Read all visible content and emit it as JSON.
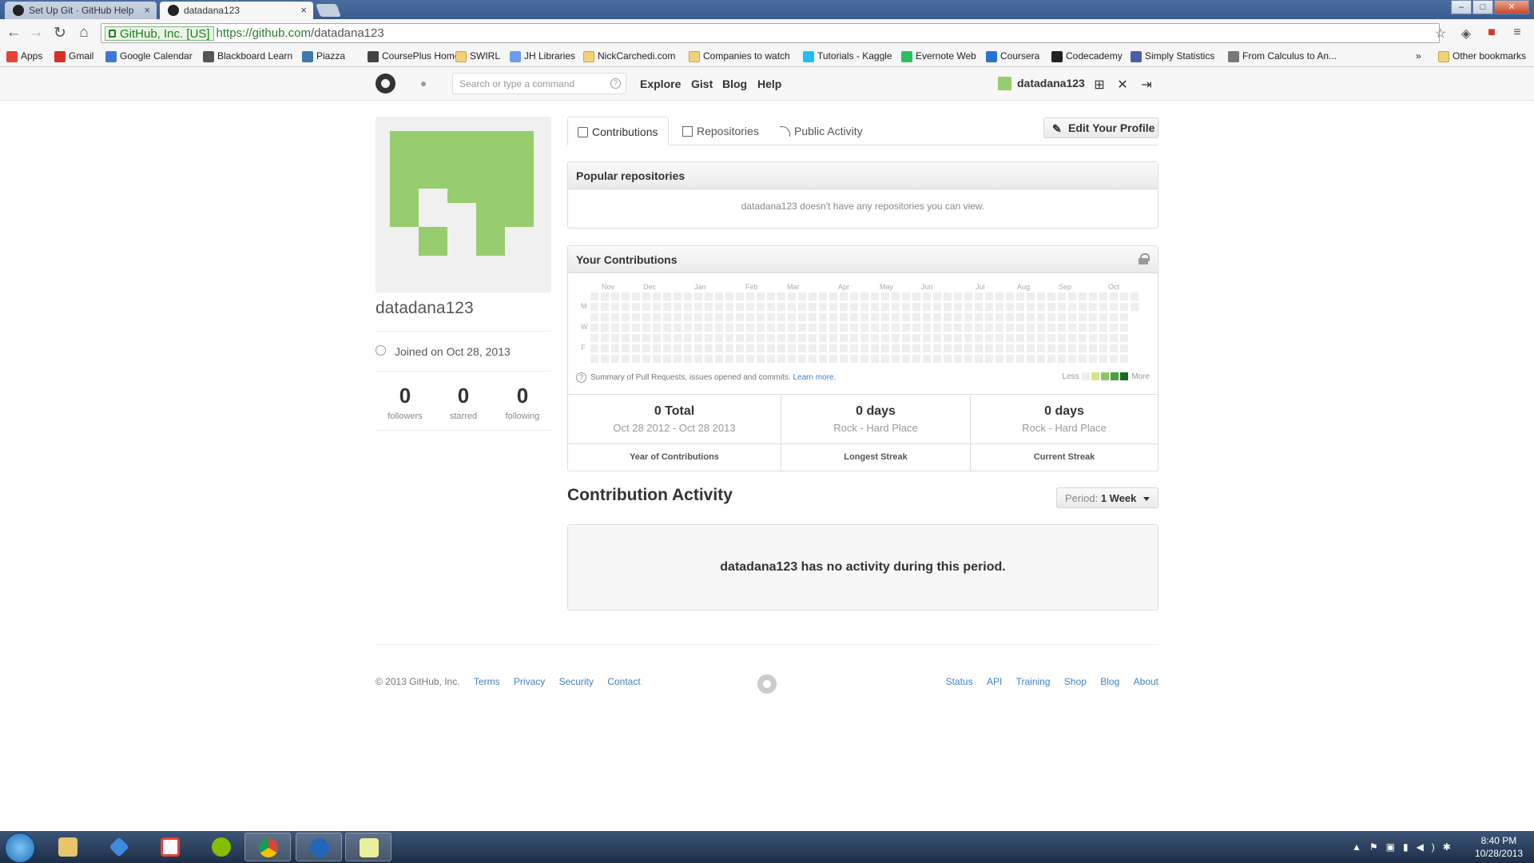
{
  "browser": {
    "tabs": [
      {
        "title": "Set Up Git · GitHub Help",
        "active": false
      },
      {
        "title": "datadana123",
        "active": true
      }
    ],
    "close_glyph": "×",
    "ev_label": "GitHub, Inc. [US]",
    "url_scheme_host": "https://github.com",
    "url_path": "/datadana123",
    "nav_icons": [
      "back-arrow-icon",
      "forward-arrow-icon",
      "reload-icon",
      "home-icon"
    ],
    "bookmarks": [
      {
        "label": "Apps",
        "icon": "apps-grid-icon",
        "color": "#e84235"
      },
      {
        "label": "Gmail",
        "icon": "gmail-icon",
        "color": "#d93025"
      },
      {
        "label": "Google Calendar",
        "icon": "calendar-icon",
        "color": "#3c78d8"
      },
      {
        "label": "Blackboard Learn",
        "icon": "blackboard-icon",
        "color": "#555555"
      },
      {
        "label": "Piazza",
        "icon": "piazza-icon",
        "color": "#3e7aab"
      },
      {
        "label": "CoursePlus Home",
        "icon": "courseplus-icon",
        "color": "#444444"
      },
      {
        "label": "SWIRL",
        "icon": "folder-icon",
        "color": "folder"
      },
      {
        "label": "JH Libraries",
        "icon": "jh-libraries-icon",
        "color": "#6d9eeb"
      },
      {
        "label": "NickCarchedi.com",
        "icon": "folder-icon",
        "color": "folder"
      },
      {
        "label": "Companies to watch",
        "icon": "folder-icon",
        "color": "folder"
      },
      {
        "label": "Tutorials - Kaggle",
        "icon": "kaggle-icon",
        "color": "#20beff"
      },
      {
        "label": "Evernote Web",
        "icon": "evernote-icon",
        "color": "#2dbe60"
      },
      {
        "label": "Coursera",
        "icon": "coursera-icon",
        "color": "#2a73cc"
      },
      {
        "label": "Codecademy",
        "icon": "codecademy-icon",
        "color": "#222222"
      },
      {
        "label": "Simply Statistics",
        "icon": "simply-statistics-icon",
        "color": "#4a5ea8"
      },
      {
        "label": "From Calculus to An...",
        "icon": "calculus-icon",
        "color": "#777777"
      }
    ],
    "overflow_chevron": "»",
    "other_bookmarks": "Other bookmarks"
  },
  "github_header": {
    "search_placeholder": "Search or type a command",
    "search_help": "?",
    "nav": [
      "Explore",
      "Gist",
      "Blog",
      "Help"
    ],
    "username": "datadana123",
    "right_icons": [
      "new-repo-icon",
      "settings-tools-icon",
      "sign-out-icon"
    ]
  },
  "profile": {
    "username": "datadana123",
    "joined": "Joined on Oct 28, 2013",
    "stats": [
      {
        "value": "0",
        "label": "followers"
      },
      {
        "value": "0",
        "label": "starred"
      },
      {
        "value": "0",
        "label": "following"
      }
    ],
    "avatar_color": "#97cd6f"
  },
  "tabs": [
    {
      "label": "Contributions",
      "selected": true
    },
    {
      "label": "Repositories",
      "selected": false
    },
    {
      "label": "Public Activity",
      "selected": false
    }
  ],
  "edit_profile": "Edit Your Profile",
  "popular_repos": {
    "title": "Popular repositories",
    "empty": "datadana123 doesn't have any repositories you can view."
  },
  "contributions": {
    "title": "Your Contributions",
    "months": [
      "Nov",
      "Dec",
      "Jan",
      "Feb",
      "Mar",
      "Apr",
      "May",
      "Jun",
      "Jul",
      "Aug",
      "Sep",
      "Oct"
    ],
    "day_labels": [
      "M",
      "W",
      "F"
    ],
    "weeks": 53,
    "total_contributions": 0,
    "summary": "Summary of Pull Requests, issues opened and commits.",
    "learn_more": "Learn more.",
    "legend_less": "Less",
    "legend_more": "More",
    "legend_colors": [
      "#eeeeee",
      "#d6e685",
      "#8cc665",
      "#44a340",
      "#1e6823"
    ],
    "stats": [
      {
        "big": "0 Total",
        "sub": "Oct 28 2012 - Oct 28 2013",
        "label": "Year of Contributions"
      },
      {
        "big": "0 days",
        "sub": "Rock - Hard Place",
        "label": "Longest Streak"
      },
      {
        "big": "0 days",
        "sub": "Rock - Hard Place",
        "label": "Current Streak"
      }
    ]
  },
  "activity": {
    "title": "Contribution Activity",
    "period_label": "Period:",
    "period_value": "1 Week",
    "empty": "datadana123 has no activity during this period."
  },
  "footer": {
    "copyright": "© 2013 GitHub, Inc.",
    "left_links": [
      "Terms",
      "Privacy",
      "Security",
      "Contact"
    ],
    "right_links": [
      "Status",
      "API",
      "Training",
      "Shop",
      "Blog",
      "About"
    ]
  },
  "taskbar": {
    "apps": [
      "file-explorer-icon",
      "dropbox-icon",
      "apps-launcher-icon",
      "spotify-icon",
      "chrome-icon",
      "r-icon",
      "rstudio-icon"
    ],
    "time": "8:40 PM",
    "date": "10/28/2013"
  }
}
